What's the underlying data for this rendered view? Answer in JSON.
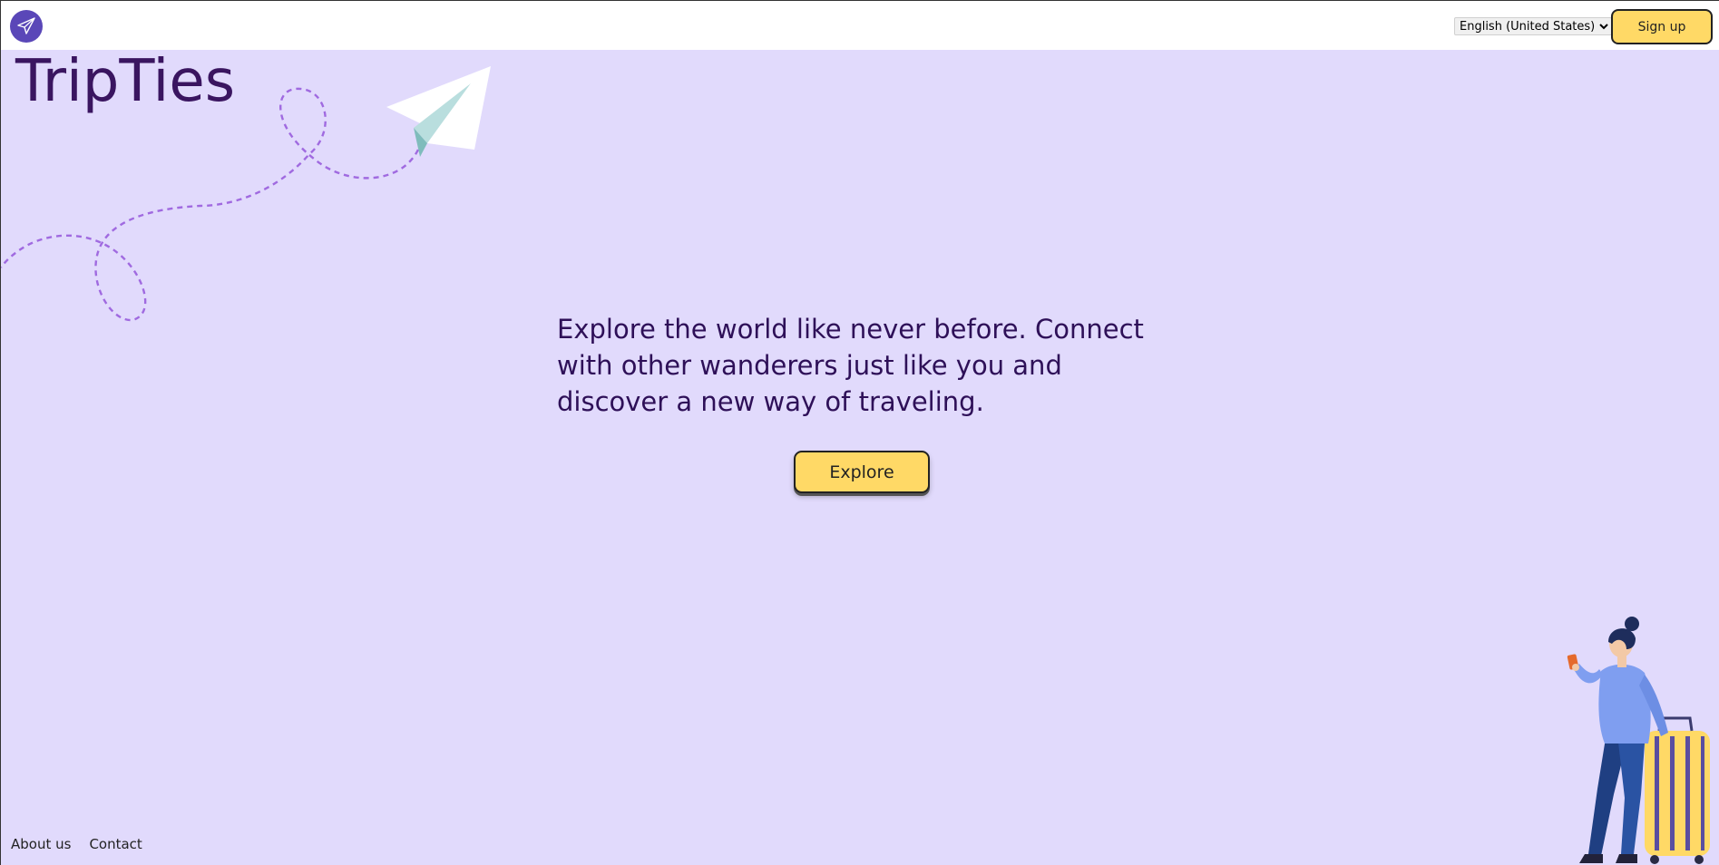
{
  "header": {
    "logo_icon": "paper-plane-icon",
    "language_select": {
      "selected": "English (United States)",
      "options": [
        "English (United States)"
      ]
    },
    "signup_label": "Sign up"
  },
  "brand": {
    "title": "TripTies"
  },
  "hero": {
    "tagline": "Explore the world like never before. Connect with other wanderers just like you and discover a new way of traveling.",
    "explore_label": "Explore"
  },
  "footer": {
    "links": [
      {
        "label": "About us"
      },
      {
        "label": "Contact"
      }
    ]
  },
  "illustrations": {
    "paper_plane": "paper-plane-illustration",
    "traveler": "traveler-with-suitcase-illustration"
  },
  "colors": {
    "background": "#e1dafc",
    "accent_button": "#ffd966",
    "brand_text": "#3a1560",
    "logo_badge": "#5a47b8",
    "dashed_path": "#a06ae0"
  }
}
